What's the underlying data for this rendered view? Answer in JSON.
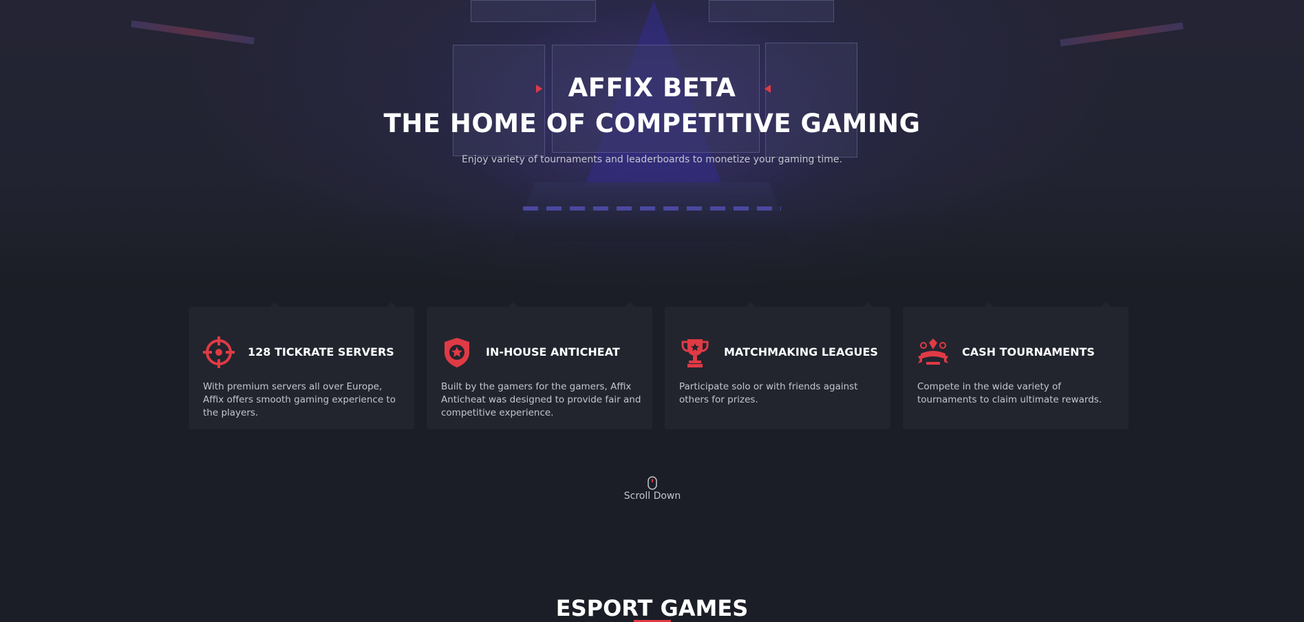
{
  "hero": {
    "title_line1": "AFFIX BETA",
    "title_line2": "THE HOME OF COMPETITIVE GAMING",
    "subtitle": "Enjoy variety of tournaments and leaderboards to monetize your gaming time."
  },
  "features": [
    {
      "icon": "crosshair-icon",
      "title": "128 TICKRATE SERVERS",
      "text": "With premium servers all over Europe, Affix offers smooth gaming experience to the players."
    },
    {
      "icon": "shield-star-icon",
      "title": "IN-HOUSE ANTICHEAT",
      "text": "Built by the gamers for the gamers, Affix Anticheat was designed to provide fair and competitive experience."
    },
    {
      "icon": "trophy-icon",
      "title": "MATCHMAKING LEAGUES",
      "text": "Participate solo or with friends against others for prizes."
    },
    {
      "icon": "cash-badge-icon",
      "title": "CASH TOURNAMENTS",
      "text": "Compete in the wide variety of tournaments to claim ultimate rewards."
    }
  ],
  "scroll": {
    "icon": "mouse-icon",
    "label": "Scroll Down"
  },
  "section": {
    "title": "ESPORT GAMES"
  },
  "colors": {
    "background": "#1b1e26",
    "card": "#22252e",
    "accent": "#e03a45",
    "text_muted": "#c3c5cf"
  }
}
